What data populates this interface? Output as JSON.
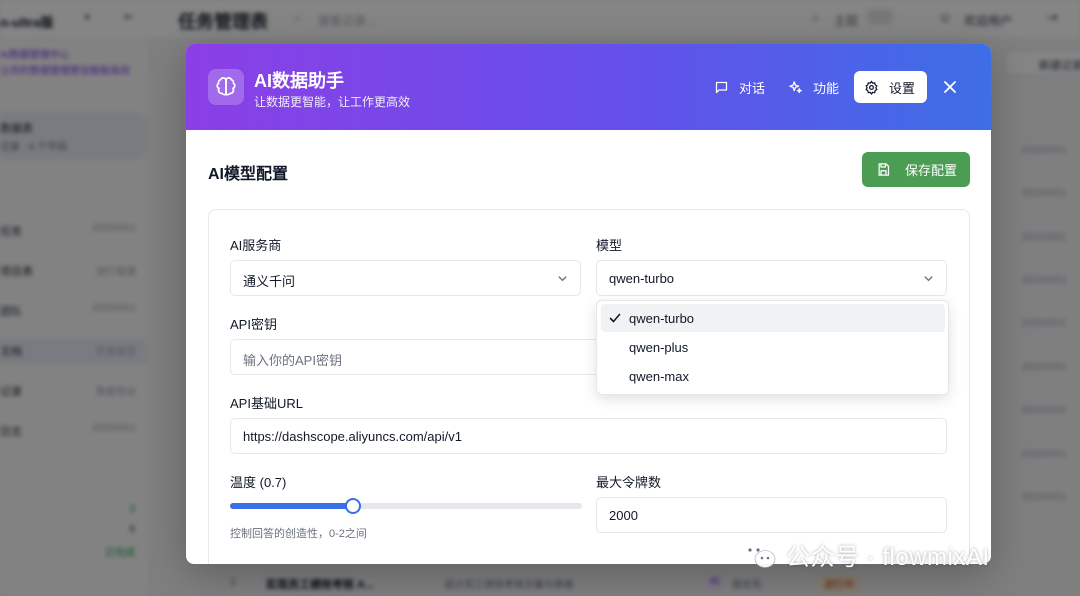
{
  "background": {
    "brand": "n-ultra版",
    "page_title": "任务管理表",
    "search_placeholder": "搜索记录...",
    "theme_label": "主题",
    "user_name": "欢迎用户",
    "sidebar_promo_line1": "AI数据管理中心",
    "sidebar_promo_line2": "让你的数据管理更加智能高效",
    "sidebar_card_title": "数据表",
    "sidebar_card_sub": "记录 · 6 个字段",
    "sidebar_items": [
      {
        "label": "任务",
        "value": "2025/0/01"
      },
      {
        "label": "项目表",
        "value": "进行管理"
      },
      {
        "label": "团队",
        "value": "2025/0/01"
      },
      {
        "label": "文档",
        "value": "开发规范"
      },
      {
        "label": "记录",
        "value": "数据导出"
      },
      {
        "label": "日志",
        "value": "2025/0/01"
      }
    ],
    "sidebar_stats": [
      "3",
      "6",
      "已完成"
    ],
    "right_button": "新建记录",
    "dates": [
      "2025/0/01",
      "2025/0/01",
      "2025/0/01",
      "2025/0/01",
      "2025/0/01",
      "2025/0/01",
      "2025/0/01",
      "2025/0/01",
      "2025/0/01"
    ],
    "row": {
      "num": "1",
      "title": "实现员工绩效考核 A...",
      "desc": "设计员工绩效考核方案与表格",
      "tag1": "AI",
      "tag2": "高优先",
      "tag3": "进行中"
    }
  },
  "modal": {
    "title": "AI数据助手",
    "subtitle": "让数据更智能，让工作更高效",
    "tabs": [
      {
        "label": "对话",
        "icon": "chat-icon",
        "active": false
      },
      {
        "label": "功能",
        "icon": "sparkle-icon",
        "active": false
      },
      {
        "label": "设置",
        "icon": "gear-icon",
        "active": true
      }
    ],
    "section_title": "AI模型配置",
    "save_label": "保存配置",
    "provider": {
      "label": "AI服务商",
      "value": "通义千问"
    },
    "model": {
      "label": "模型",
      "value": "qwen-turbo",
      "options": [
        "qwen-turbo",
        "qwen-plus",
        "qwen-max"
      ],
      "selected_index": 0
    },
    "api_key": {
      "label": "API密钥",
      "placeholder": "输入你的API密钥"
    },
    "base_url": {
      "label": "API基础URL",
      "value": "https://dashscope.aliyuncs.com/api/v1"
    },
    "temperature": {
      "label": "温度 (0.7)",
      "value": 0.7,
      "min": 0,
      "max": 2,
      "hint": "控制回答的创造性，0-2之间"
    },
    "max_tokens": {
      "label": "最大令牌数",
      "value": "2000"
    }
  },
  "watermark": "公众号 · flowmixAI",
  "colors": {
    "header_start": "#8b3fe6",
    "header_end": "#3d6ee6",
    "save_button": "#4a9d52",
    "slider": "#3b6fe8"
  }
}
